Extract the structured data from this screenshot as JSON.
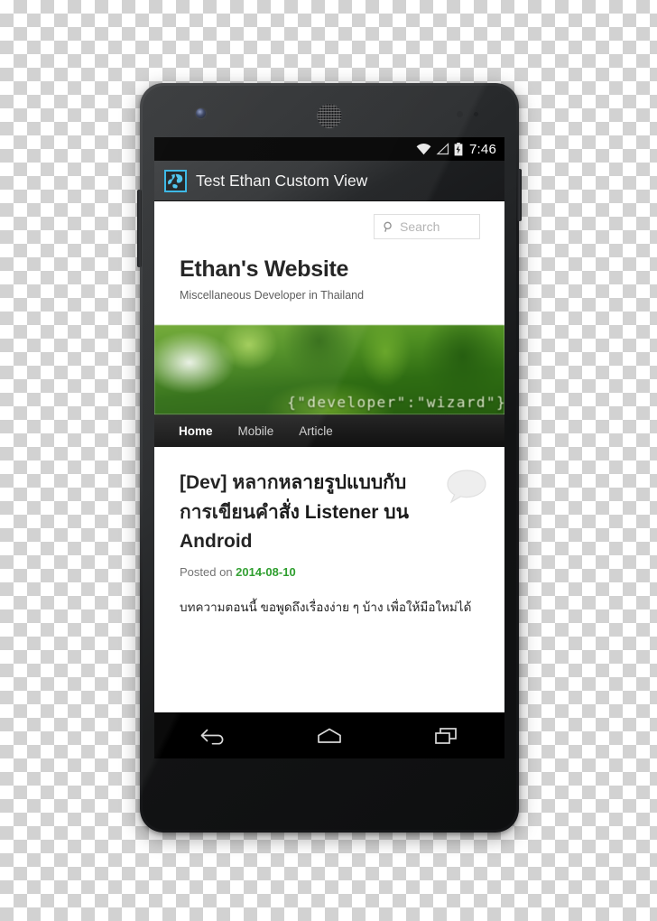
{
  "device": {
    "name": "android-smartphone",
    "hardware": {
      "front_camera": "front-camera",
      "earpiece": "earpiece-speaker",
      "power_button": "power-button",
      "volume_rocker": "volume-rocker"
    }
  },
  "status_bar": {
    "time": "7:46",
    "icons": [
      "wifi-icon",
      "signal-icon",
      "battery-charging-icon"
    ]
  },
  "action_bar": {
    "title": "Test Ethan Custom View",
    "app_icon": "globe-icon",
    "icon_border_color": "#33b5e5"
  },
  "webpage": {
    "search": {
      "placeholder": "Search",
      "icon": "search-icon"
    },
    "site_title": "Ethan's Website",
    "tagline": "Miscellaneous Developer in Thailand",
    "banner": {
      "code_text": "{\"developer\":\"wizard\"}",
      "theme_color": "#2f6d13"
    },
    "nav": [
      {
        "label": "Home",
        "active": true
      },
      {
        "label": "Mobile",
        "active": false
      },
      {
        "label": "Article",
        "active": false
      }
    ],
    "article": {
      "title": "[Dev] หลากหลายรูปแบบกับการเขียนคำสั่ง Listener บน Android",
      "posted_label": "Posted on",
      "date": "2014-08-10",
      "date_color": "#2e9e2e",
      "comment_icon": "comment-bubble-icon",
      "body": "บทความตอนนี้ ขอพูดถึงเรื่องง่าย ๆ บ้าง เพื่อให้มือใหม่ได้"
    }
  },
  "android_navbar": {
    "buttons": [
      {
        "name": "back-button",
        "icon": "back-arrow-icon"
      },
      {
        "name": "home-button",
        "icon": "home-icon"
      },
      {
        "name": "recents-button",
        "icon": "recents-icon"
      }
    ]
  }
}
